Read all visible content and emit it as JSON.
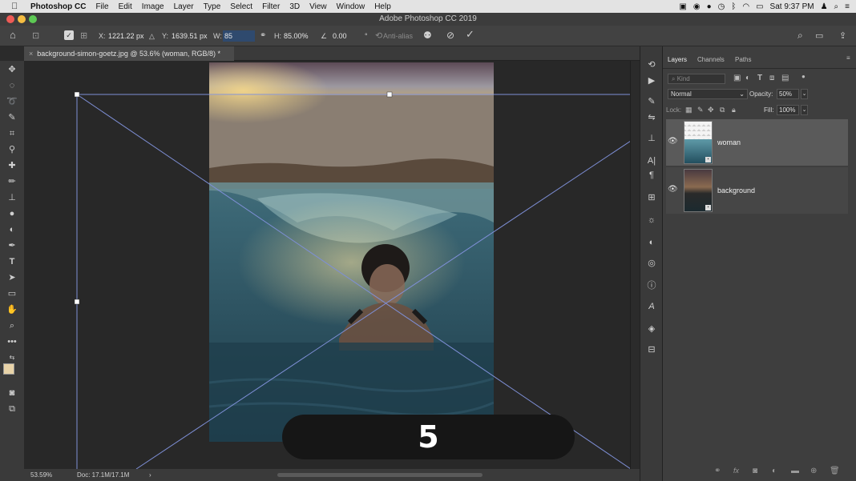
{
  "menubar": {
    "app_name": "Photoshop CC",
    "items": [
      "File",
      "Edit",
      "Image",
      "Layer",
      "Type",
      "Select",
      "Filter",
      "3D",
      "View",
      "Window",
      "Help"
    ],
    "clock": "Sat 9:37 PM"
  },
  "window": {
    "title": "Adobe Photoshop CC 2019"
  },
  "options": {
    "x_label": "X:",
    "x_value": "1221.22 px",
    "y_label": "Y:",
    "y_value": "1639.51 px",
    "w_label": "W:",
    "w_value": "85",
    "h_label": "H:",
    "h_value": "85.00%",
    "angle_value": "0.00",
    "angle_unit": "°",
    "antialias_label": "Anti-alias"
  },
  "document": {
    "tab_title": "background-simon-goetz.jpg @ 53.6% (woman, RGB/8) *"
  },
  "status": {
    "zoom": "53.59%",
    "doc": "Doc: 17.1M/17.1M",
    "arrow": "›"
  },
  "layers_panel": {
    "tabs": [
      "Layers",
      "Channels",
      "Paths"
    ],
    "filter_placeholder": "Kind",
    "blend_mode": "Normal",
    "opacity_label": "Opacity:",
    "opacity_value": "50%",
    "lock_label": "Lock:",
    "fill_label": "Fill:",
    "fill_value": "100%",
    "layers": [
      {
        "name": "woman",
        "selected": true
      },
      {
        "name": "background",
        "selected": false
      }
    ]
  },
  "overlay": {
    "step_number": "5"
  },
  "colors": {
    "menubar_bg": "#e3e3e3",
    "panel_bg": "#3e3e3e",
    "canvas_bg": "#282828",
    "transform_line": "#7e8fd6",
    "close": "#ee5b56",
    "minimize": "#f5bd42",
    "maximize": "#5dc954",
    "foreground_swatch": "#e8d3a8"
  }
}
